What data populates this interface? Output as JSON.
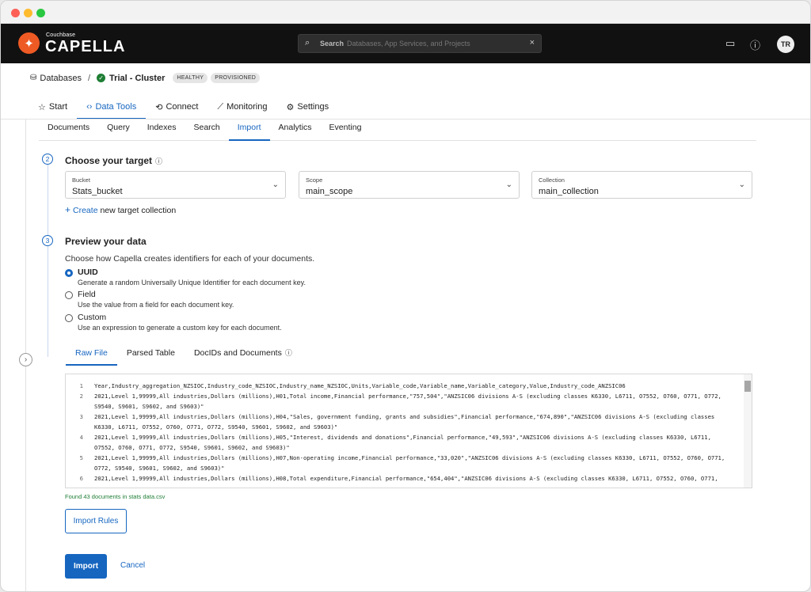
{
  "window": {
    "colors": {
      "close": "#fd5f57",
      "minimize": "#febb2e",
      "zoom": "#29c840"
    }
  },
  "brand": {
    "small": "Couchbase",
    "name": "CAPELLA",
    "accent": "#ee5a24"
  },
  "search": {
    "label": "Search",
    "placeholder": "Databases, App Services, and Projects",
    "clear": "×"
  },
  "topbar": {
    "avatar": "TR",
    "icons": [
      "terminal-icon",
      "help-icon"
    ]
  },
  "breadcrumb": {
    "root": "Databases",
    "separator": "/",
    "cluster": "Trial - Cluster",
    "badges": [
      "HEALTHY",
      "PROVISIONED"
    ]
  },
  "nav": {
    "items": [
      {
        "label": "Start",
        "icon": "☆"
      },
      {
        "label": "Data Tools",
        "icon": "‹›"
      },
      {
        "label": "Connect",
        "icon": "⟲"
      },
      {
        "label": "Monitoring",
        "icon": "⟋"
      },
      {
        "label": "Settings",
        "icon": "⚙"
      }
    ],
    "active": "Data Tools"
  },
  "subnav": {
    "items": [
      "Documents",
      "Query",
      "Indexes",
      "Search",
      "Import",
      "Analytics",
      "Eventing"
    ],
    "active": "Import"
  },
  "step2": {
    "number": "2",
    "title": "Choose your target",
    "bucket": {
      "label": "Bucket",
      "value": "Stats_bucket"
    },
    "scope": {
      "label": "Scope",
      "value": "main_scope"
    },
    "collection": {
      "label": "Collection",
      "value": "main_collection"
    },
    "create": {
      "action": "Create",
      "rest": " new target collection"
    }
  },
  "step3": {
    "number": "3",
    "title": "Preview your data",
    "description": "Choose how Capella creates identifiers for each of your documents.",
    "options": [
      {
        "title": "UUID",
        "sub": "Generate a random Universally Unique Identifier for each document key.",
        "selected": true
      },
      {
        "title": "Field",
        "sub": "Use the value from a field for each document key.",
        "selected": false
      },
      {
        "title": "Custom",
        "sub": "Use an expression to generate a custom key for each document.",
        "selected": false
      }
    ]
  },
  "preview_tabs": {
    "items": [
      "Raw File",
      "Parsed Table",
      "DocIDs and Documents"
    ],
    "active": "Raw File"
  },
  "code": {
    "lines": [
      {
        "n": "1",
        "rows": [
          "Year,Industry_aggregation_NZSIOC,Industry_code_NZSIOC,Industry_name_NZSIOC,Units,Variable_code,Variable_name,Variable_category,Value,Industry_code_ANZSIC06"
        ]
      },
      {
        "n": "2",
        "rows": [
          "2021,Level 1,99999,All industries,Dollars (millions),H01,Total income,Financial performance,\"757,504\",\"ANZSIC06 divisions A-S (excluding classes K6330, L6711, O7552, O760, O771, O772,",
          "S9540, S9601, S9602, and S9603)\""
        ]
      },
      {
        "n": "3",
        "rows": [
          "2021,Level 1,99999,All industries,Dollars (millions),H04,\"Sales, government funding, grants and subsidies\",Financial performance,\"674,890\",\"ANZSIC06 divisions A-S (excluding classes",
          "K6330, L6711, O7552, O760, O771, O772, S9540, S9601, S9602, and S9603)\""
        ]
      },
      {
        "n": "4",
        "rows": [
          "2021,Level 1,99999,All industries,Dollars (millions),H05,\"Interest, dividends and donations\",Financial performance,\"49,593\",\"ANZSIC06 divisions A-S (excluding classes K6330, L6711,",
          "O7552, O760, O771, O772, S9540, S9601, S9602, and S9603)\""
        ]
      },
      {
        "n": "5",
        "rows": [
          "2021,Level 1,99999,All industries,Dollars (millions),H07,Non-operating income,Financial performance,\"33,020\",\"ANZSIC06 divisions A-S (excluding classes K6330, L6711, O7552, O760, O771,",
          "O772, S9540, S9601, S9602, and S9603)\""
        ]
      },
      {
        "n": "6",
        "rows": [
          "2021,Level 1,99999,All industries,Dollars (millions),H08,Total expenditure,Financial performance,\"654,404\",\"ANZSIC06 divisions A-S (excluding classes K6330, L6711, O7552, O760, O771,"
        ]
      }
    ]
  },
  "found": "Found 43 documents in stats data.csv",
  "buttons": {
    "rules": "Import Rules",
    "import": "Import",
    "cancel": "Cancel"
  },
  "colors": {
    "accent": "#1666c0",
    "success": "#1e7e34"
  }
}
